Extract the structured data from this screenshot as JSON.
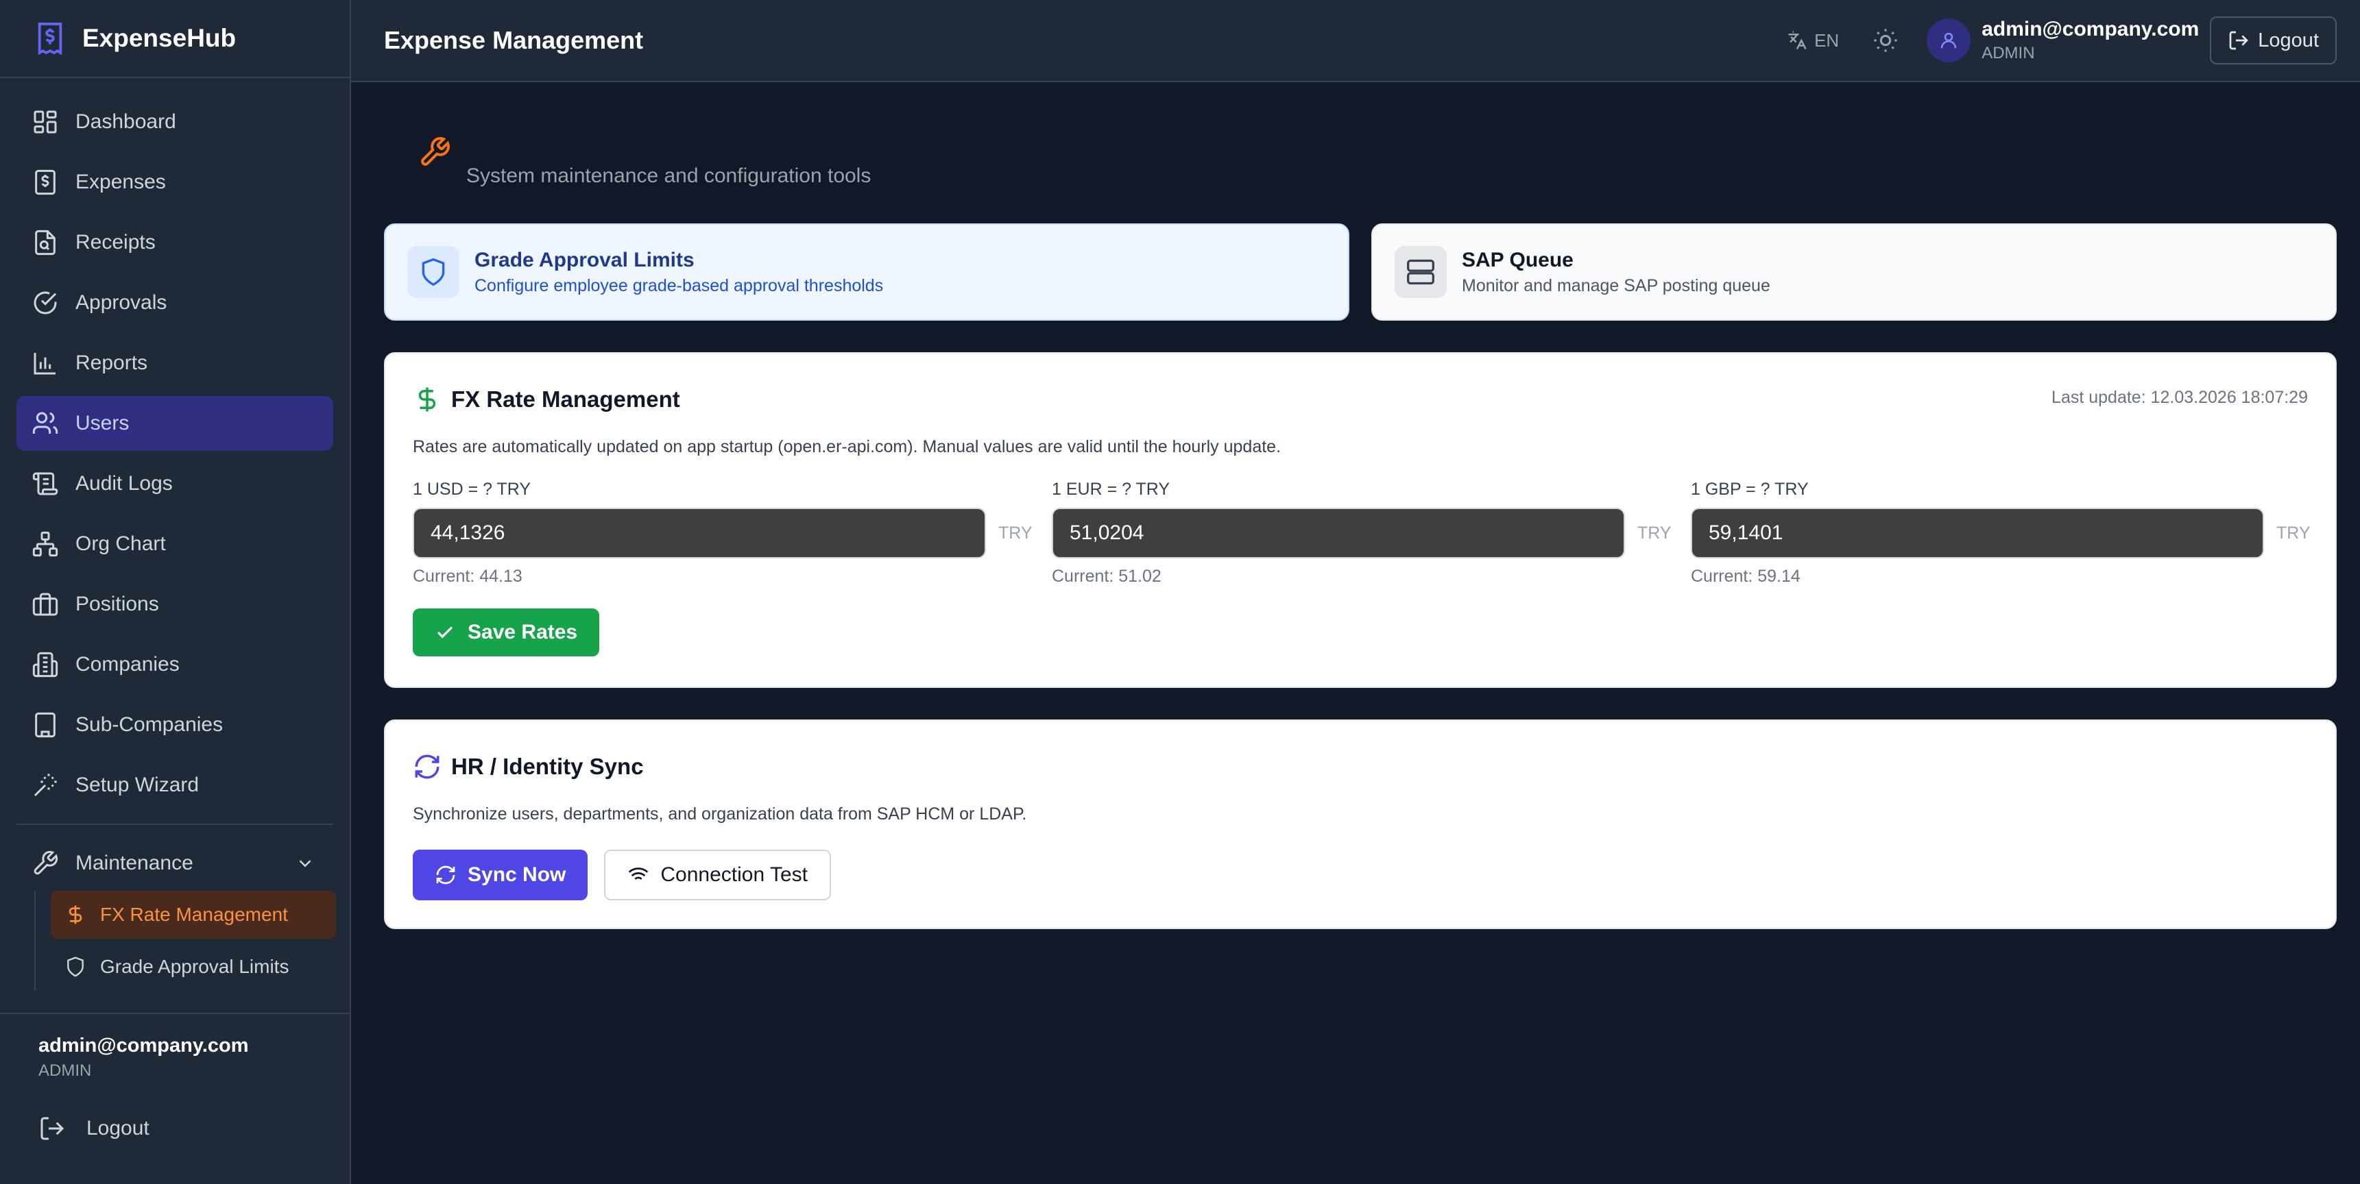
{
  "brand": {
    "name": "ExpenseHub"
  },
  "sidebar": {
    "items": [
      {
        "label": "Dashboard",
        "icon": "dashboard-icon"
      },
      {
        "label": "Expenses",
        "icon": "dollar-doc-icon"
      },
      {
        "label": "Receipts",
        "icon": "receipt-icon"
      },
      {
        "label": "Approvals",
        "icon": "check-circle-icon"
      },
      {
        "label": "Reports",
        "icon": "bar-chart-icon"
      },
      {
        "label": "Users",
        "icon": "users-icon",
        "active": true
      },
      {
        "label": "Audit Logs",
        "icon": "log-icon"
      },
      {
        "label": "Org Chart",
        "icon": "org-chart-icon"
      },
      {
        "label": "Positions",
        "icon": "briefcase-icon"
      },
      {
        "label": "Companies",
        "icon": "building-icon"
      },
      {
        "label": "Sub-Companies",
        "icon": "building-small-icon"
      },
      {
        "label": "Setup Wizard",
        "icon": "wand-icon"
      }
    ],
    "maintenance": {
      "label": "Maintenance",
      "sub_items": [
        {
          "label": "FX Rate Management",
          "active": true
        },
        {
          "label": "Grade Approval Limits"
        }
      ]
    },
    "footer": {
      "email": "admin@company.com",
      "role": "ADMIN",
      "logout": "Logout"
    }
  },
  "header": {
    "title": "Expense Management",
    "lang": "EN",
    "user_email": "admin@company.com",
    "user_role": "ADMIN",
    "logout": "Logout"
  },
  "main": {
    "subtitle": "System maintenance and configuration tools",
    "cards": {
      "grade": {
        "title": "Grade Approval Limits",
        "desc": "Configure employee grade-based approval thresholds"
      },
      "sap": {
        "title": "SAP Queue",
        "desc": "Monitor and manage SAP posting queue"
      }
    },
    "fx": {
      "title": "FX Rate Management",
      "last_update": "Last update: 12.03.2026 18:07:29",
      "desc": "Rates are automatically updated on app startup (open.er-api.com). Manual values are valid until the hourly update.",
      "rates": [
        {
          "label": "1 USD = ? TRY",
          "value": "44,1326",
          "unit": "TRY",
          "current": "Current: 44.13"
        },
        {
          "label": "1 EUR = ? TRY",
          "value": "51,0204",
          "unit": "TRY",
          "current": "Current: 51.02"
        },
        {
          "label": "1 GBP = ? TRY",
          "value": "59,1401",
          "unit": "TRY",
          "current": "Current: 59.14"
        }
      ],
      "save_label": "Save Rates"
    },
    "hr": {
      "title": "HR / Identity Sync",
      "desc": "Synchronize users, departments, and organization data from SAP HCM or LDAP.",
      "sync_label": "Sync Now",
      "test_label": "Connection Test"
    }
  },
  "colors": {
    "accent": "#4f46e5",
    "success": "#16a34a",
    "active_sub": "#fb923c",
    "bg": "#111827",
    "panel": "#1f2937"
  }
}
